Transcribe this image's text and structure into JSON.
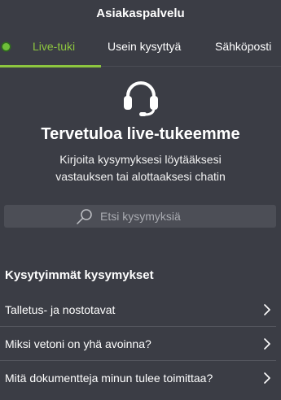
{
  "header": {
    "title": "Asiakaspalvelu"
  },
  "tabs": [
    {
      "label": "Live-tuki",
      "active": true
    },
    {
      "label": "Usein kysyttyä",
      "active": false
    },
    {
      "label": "Sähköposti",
      "active": false
    }
  ],
  "hero": {
    "icon": "headset-icon",
    "title": "Tervetuloa live-tukeemme",
    "subtitle_line1": "Kirjoita kysymyksesi löytääksesi",
    "subtitle_line2": "vastauksen tai alottaaksesi chatin"
  },
  "search": {
    "placeholder": "Etsi kysymyksiä",
    "icon": "search-icon"
  },
  "faq": {
    "heading": "Kysytyimmät kysymykset",
    "items": [
      {
        "label": "Talletus- ja nostotavat"
      },
      {
        "label": "Miksi vetoni on yhä avoinna?"
      },
      {
        "label": "Mitä dokumentteja minun tulee toimittaa?"
      }
    ]
  },
  "colors": {
    "background": "#3b3d45",
    "accent": "#8dc63f",
    "online_dot": "#6fbf3a",
    "search_bg": "#4c4e56"
  }
}
